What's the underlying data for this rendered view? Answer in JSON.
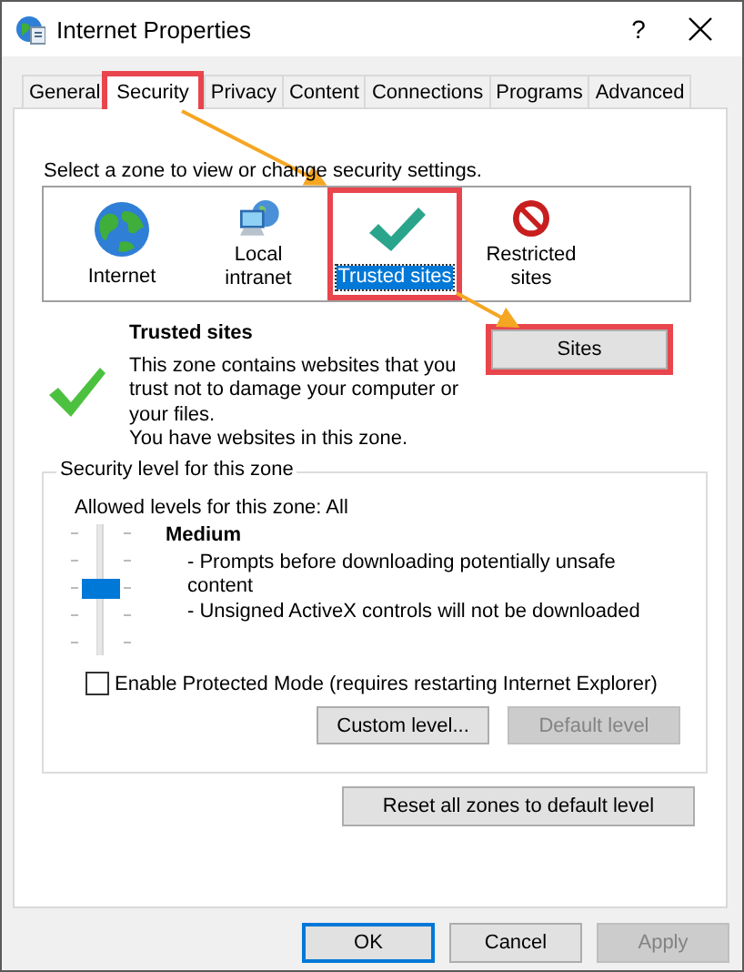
{
  "window": {
    "title": "Internet Properties",
    "help": "?"
  },
  "tabs": [
    {
      "label": "General",
      "selected": false,
      "highlighted": false
    },
    {
      "label": "Security",
      "selected": true,
      "highlighted": true
    },
    {
      "label": "Privacy",
      "selected": false,
      "highlighted": false
    },
    {
      "label": "Content",
      "selected": false,
      "highlighted": false
    },
    {
      "label": "Connections",
      "selected": false,
      "highlighted": false
    },
    {
      "label": "Programs",
      "selected": false,
      "highlighted": false
    },
    {
      "label": "Advanced",
      "selected": false,
      "highlighted": false
    }
  ],
  "security": {
    "prompt": "Select a zone to view or change security settings.",
    "zones": [
      {
        "label": "Internet",
        "kind": "globe",
        "selected": false,
        "highlighted": false
      },
      {
        "label": "Local intranet",
        "kind": "network",
        "selected": false,
        "highlighted": false
      },
      {
        "label": "Trusted sites",
        "kind": "trusted",
        "selected": true,
        "highlighted": true
      },
      {
        "label": "Restricted sites",
        "kind": "restricted",
        "selected": false,
        "highlighted": false
      }
    ],
    "zone_info": {
      "title": "Trusted sites",
      "description": "This zone contains websites that you trust not to damage your computer or your files.",
      "note": "You have websites in this zone."
    },
    "sites_button": {
      "label": "Sites",
      "highlighted": true
    },
    "level_group": {
      "title": "Security level for this zone",
      "allowed": "Allowed levels for this zone: All",
      "slider": {
        "level": 0.5
      },
      "level_name": "Medium",
      "details": [
        "- Prompts before downloading potentially unsafe content",
        "- Unsigned ActiveX controls will not be downloaded"
      ],
      "protected_mode": {
        "label": "Enable Protected Mode (requires restarting Internet Explorer)",
        "checked": false
      },
      "buttons": [
        {
          "label": "Custom level...",
          "disabled": false
        },
        {
          "label": "Default level",
          "disabled": true
        }
      ]
    },
    "reset_button": {
      "label": "Reset all zones to default level",
      "disabled": false
    }
  },
  "buttons": [
    {
      "label": "OK",
      "default": true,
      "disabled": false
    },
    {
      "label": "Cancel",
      "default": false,
      "disabled": false
    },
    {
      "label": "Apply",
      "default": false,
      "disabled": true
    }
  ]
}
